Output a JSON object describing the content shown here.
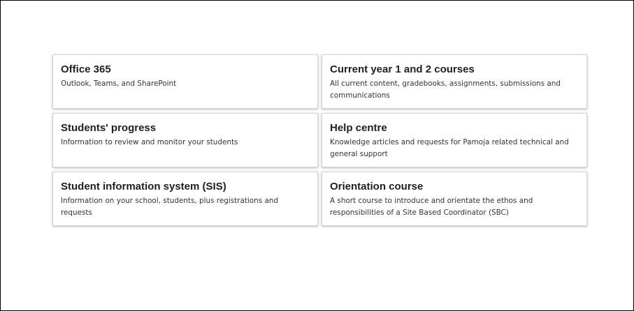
{
  "cards": [
    {
      "title": "Office 365",
      "description": "Outlook, Teams, and SharePoint"
    },
    {
      "title": "Current year 1 and 2 courses",
      "description": "All current content, gradebooks, assignments, submissions and communications"
    },
    {
      "title": "Students' progress",
      "description": "Information to review and monitor your students"
    },
    {
      "title": "Help centre",
      "description": "Knowledge articles and requests for Pamoja related technical and general support"
    },
    {
      "title": "Student information system (SIS)",
      "description": "Information on your school, students, plus registrations and requests"
    },
    {
      "title": "Orientation course",
      "description": "A short course to introduce and orientate the ethos and responsibilities of a Site Based Coordinator (SBC)"
    }
  ]
}
